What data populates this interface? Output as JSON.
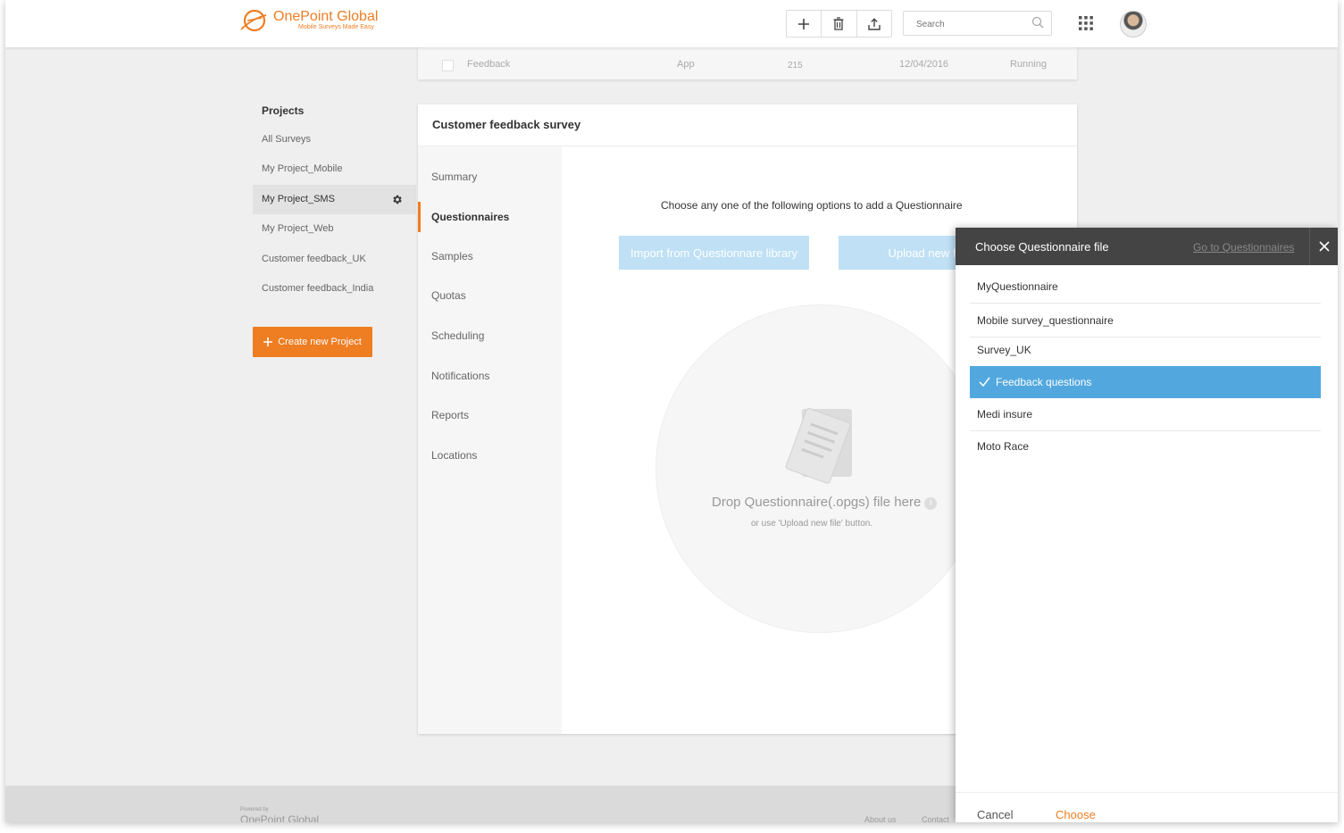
{
  "brand": {
    "name": "OnePoint Global",
    "tagline": "Mobile Surveys Made Easy",
    "color": "#ef7d22"
  },
  "header": {
    "search_placeholder": "Search"
  },
  "top_row": {
    "name": "Feedback",
    "type": "App",
    "count": "215",
    "date": "12/04/2016",
    "status": "Running"
  },
  "projects": {
    "title": "Projects",
    "items": [
      {
        "label": "All Surveys"
      },
      {
        "label": "My Project_Mobile"
      },
      {
        "label": "My Project_SMS"
      },
      {
        "label": "My Project_Web"
      },
      {
        "label": "Customer feedback_UK"
      },
      {
        "label": "Customer feedback_India"
      }
    ],
    "create_label": "Create new Project"
  },
  "card": {
    "title": "Customer feedback survey",
    "tabs": [
      {
        "label": "Summary"
      },
      {
        "label": "Questionnaires"
      },
      {
        "label": "Samples"
      },
      {
        "label": "Quotas"
      },
      {
        "label": "Scheduling"
      },
      {
        "label": "Notifications"
      },
      {
        "label": "Reports"
      },
      {
        "label": "Locations"
      }
    ],
    "instruction": "Choose any one of the following options to add a Questionnaire",
    "import_label": "Import from Questionnare library",
    "upload_label": "Upload new file",
    "drop_text": "Drop Questionnaire(.opgs) file here",
    "drop_sub": "or use 'Upload new file' button."
  },
  "footer": {
    "powered_by": "Powered by",
    "brand": "OnePoint Global",
    "links": [
      "About us",
      "Contact"
    ]
  },
  "panel": {
    "title": "Choose Questionnaire file",
    "link": "Go to Questionnaires",
    "files": [
      {
        "label": "MyQuestionnaire"
      },
      {
        "label": "Mobile survey_questionnaire"
      },
      {
        "label": "Survey_UK"
      },
      {
        "label": "Feedback questions"
      },
      {
        "label": "Medi insure"
      },
      {
        "label": "Moto Race"
      }
    ],
    "cancel_label": "Cancel",
    "choose_label": "Choose",
    "selected_color": "#52a8de"
  }
}
